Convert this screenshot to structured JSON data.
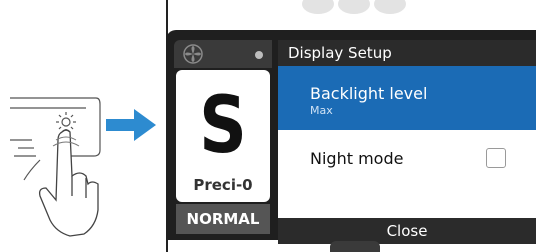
{
  "dialog": {
    "title": "Display Setup",
    "items": [
      {
        "label": "Backlight level",
        "value": "Max",
        "selected": true
      },
      {
        "label": "Night mode",
        "checked": false
      }
    ],
    "close_label": "Close"
  },
  "mode_panel": {
    "letter": "S",
    "sub_label": "Preci-0",
    "status": "NORMAL"
  },
  "icons": [
    "hand-press-icon",
    "sun-icon",
    "arrow-right-icon",
    "fan-icon",
    "status-dot-icon"
  ],
  "colors": {
    "accent": "#1b6bb5",
    "arrow": "#2d8bd0",
    "dark": "#2b2b2b"
  }
}
